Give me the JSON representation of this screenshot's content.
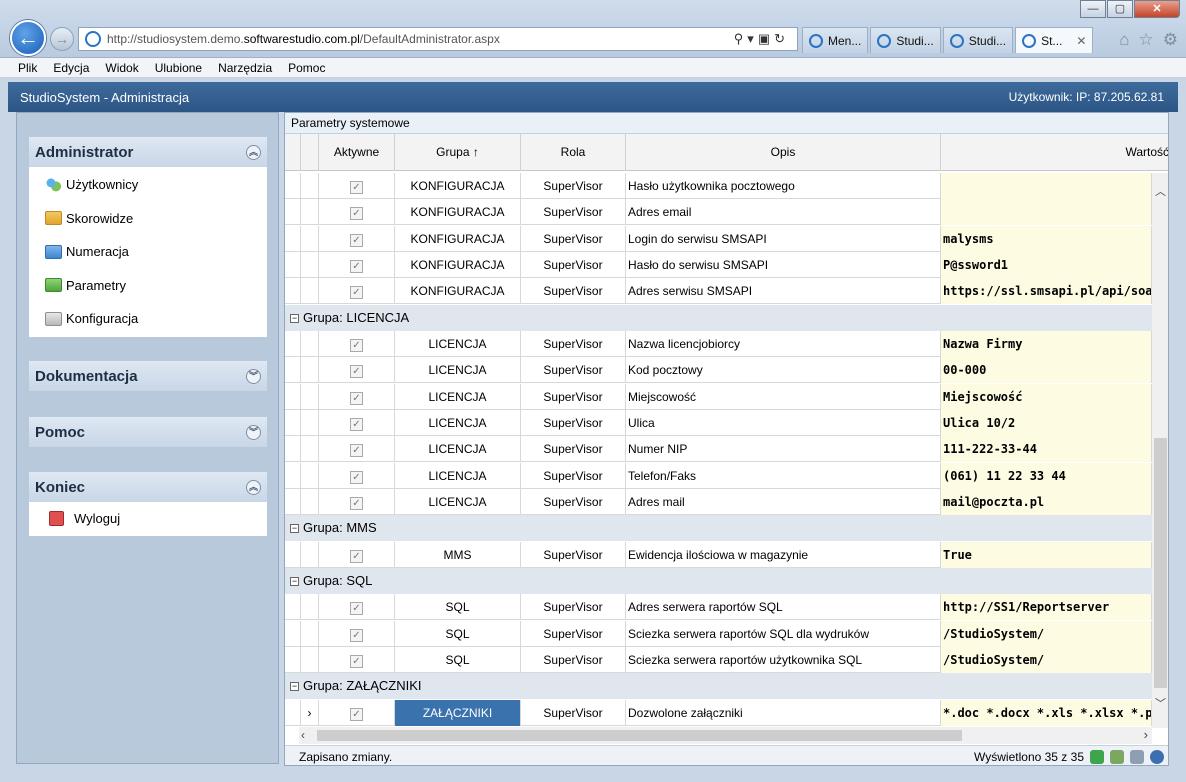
{
  "browser": {
    "url_prefix": "http://studiosystem.demo.",
    "url_domain": "softwarestudio.com.pl",
    "url_path": "/DefaultAdministrator.aspx",
    "tabs": [
      "Men...",
      "Studi...",
      "Studi...",
      "St..."
    ],
    "menu": [
      "Plik",
      "Edycja",
      "Widok",
      "Ulubione",
      "Narzędzia",
      "Pomoc"
    ]
  },
  "app": {
    "title": "StudioSystem - Administracja",
    "user": "Użytkownik: IP: 87.205.62.81"
  },
  "sidebar": {
    "admin": {
      "title": "Administrator",
      "items": [
        "Użytkownicy",
        "Skorowidze",
        "Numeracja",
        "Parametry",
        "Konfiguracja"
      ]
    },
    "dokumentacja": "Dokumentacja",
    "pomoc": "Pomoc",
    "koniec": {
      "title": "Koniec",
      "item": "Wyloguj"
    }
  },
  "grid": {
    "title": "Parametry systemowe",
    "columns": [
      "Aktywne",
      "Grupa ↑",
      "Rola",
      "Opis",
      "Wartość"
    ],
    "rows": [
      {
        "grupa": "KONFIGURACJA",
        "rola": "SuperVisor",
        "opis": "Hasło użytkownika pocztowego",
        "wartosc": ""
      },
      {
        "grupa": "KONFIGURACJA",
        "rola": "SuperVisor",
        "opis": "Adres email",
        "wartosc": ""
      },
      {
        "grupa": "KONFIGURACJA",
        "rola": "SuperVisor",
        "opis": "Login do serwisu SMSAPI",
        "wartosc": "malysms"
      },
      {
        "grupa": "KONFIGURACJA",
        "rola": "SuperVisor",
        "opis": "Hasło do serwisu SMSAPI",
        "wartosc": "P@ssword1"
      },
      {
        "grupa": "KONFIGURACJA",
        "rola": "SuperVisor",
        "opis": "Adres serwisu SMSAPI",
        "wartosc": "https://ssl.smsapi.pl/api/soap/"
      },
      {
        "group": "Grupa: LICENCJA"
      },
      {
        "grupa": "LICENCJA",
        "rola": "SuperVisor",
        "opis": "Nazwa licencjobiorcy",
        "wartosc": "Nazwa Firmy"
      },
      {
        "grupa": "LICENCJA",
        "rola": "SuperVisor",
        "opis": "Kod pocztowy",
        "wartosc": "00-000"
      },
      {
        "grupa": "LICENCJA",
        "rola": "SuperVisor",
        "opis": "Miejscowość",
        "wartosc": "Miejscowość"
      },
      {
        "grupa": "LICENCJA",
        "rola": "SuperVisor",
        "opis": "Ulica",
        "wartosc": "Ulica 10/2"
      },
      {
        "grupa": "LICENCJA",
        "rola": "SuperVisor",
        "opis": "Numer NIP",
        "wartosc": "111-222-33-44"
      },
      {
        "grupa": "LICENCJA",
        "rola": "SuperVisor",
        "opis": "Telefon/Faks",
        "wartosc": "(061) 11 22 33 44"
      },
      {
        "grupa": "LICENCJA",
        "rola": "SuperVisor",
        "opis": "Adres mail",
        "wartosc": "mail@poczta.pl"
      },
      {
        "group": "Grupa: MMS"
      },
      {
        "grupa": "MMS",
        "rola": "SuperVisor",
        "opis": "Ewidencja ilościowa w magazynie",
        "wartosc": "True"
      },
      {
        "group": "Grupa: SQL"
      },
      {
        "grupa": "SQL",
        "rola": "SuperVisor",
        "opis": "Adres serwera raportów SQL",
        "wartosc": "http://SS1/Reportserver"
      },
      {
        "grupa": "SQL",
        "rola": "SuperVisor",
        "opis": "Sciezka serwera raportów SQL dla wydruków",
        "wartosc": "/StudioSystem/"
      },
      {
        "grupa": "SQL",
        "rola": "SuperVisor",
        "opis": "Sciezka serwera raportów użytkownika SQL",
        "wartosc": "/StudioSystem/"
      },
      {
        "group": "Grupa: ZAŁĄCZNIKI"
      },
      {
        "grupa": "ZAŁĄCZNIKI",
        "rola": "SuperVisor",
        "opis": "Dozwolone załączniki",
        "wartosc": "*.doc *.docx *.xls *.xlsx *.ppt *",
        "selected": true
      }
    ],
    "status": "Zapisano zmiany.",
    "count": "Wyświetlono 35 z 35"
  }
}
